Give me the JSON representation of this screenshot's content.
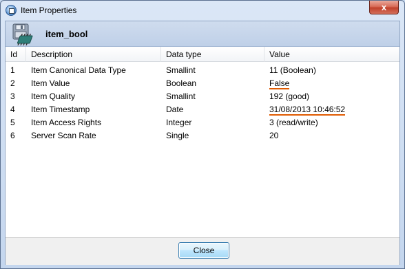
{
  "window": {
    "title": "Item Properties",
    "close_glyph": "x"
  },
  "header": {
    "item_name": "item_bool",
    "icon": "chip-disk-icon"
  },
  "table": {
    "columns": [
      "Id",
      "Description",
      "Data type",
      "Value"
    ],
    "rows": [
      {
        "id": "1",
        "description": "Item Canonical Data Type",
        "type": "Smallint",
        "value": "11 (Boolean)"
      },
      {
        "id": "2",
        "description": "Item Value",
        "type": "Boolean",
        "value": "False"
      },
      {
        "id": "3",
        "description": "Item Quality",
        "type": "Smallint",
        "value": "192 (good)"
      },
      {
        "id": "4",
        "description": "Item Timestamp",
        "type": "Date",
        "value": "31/08/2013 10:46:52"
      },
      {
        "id": "5",
        "description": "Item Access Rights",
        "type": "Integer",
        "value": "3 (read/write)"
      },
      {
        "id": "6",
        "description": "Server Scan Rate",
        "type": "Single",
        "value": "20"
      }
    ]
  },
  "footer": {
    "close_label": "Close"
  },
  "colors": {
    "accent_underline": "#e05a00",
    "close_button_red": "#c0402b"
  }
}
